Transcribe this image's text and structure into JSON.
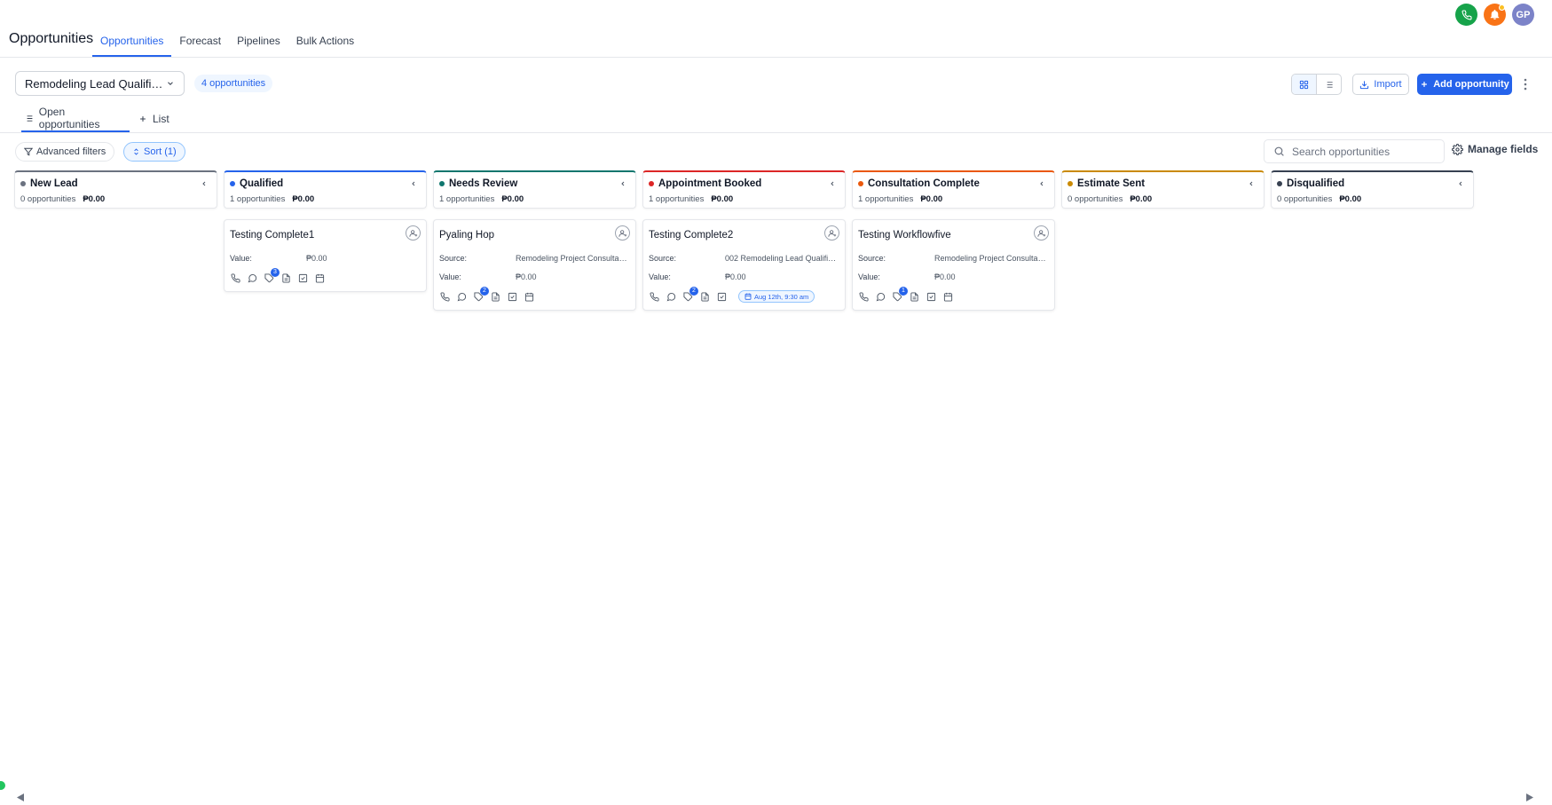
{
  "app": {
    "title": "Opportunities",
    "nav_tabs": [
      "Opportunities",
      "Forecast",
      "Pipelines",
      "Bulk Actions"
    ],
    "user_initials": "GP"
  },
  "toolbar": {
    "pipeline": "Remodeling Lead Qualificati...",
    "count_badge": "4 opportunities",
    "import_label": "Import",
    "add_label": "Add opportunity"
  },
  "subtabs": {
    "open": "Open opportunities",
    "list": "List"
  },
  "filters": {
    "advanced": "Advanced filters",
    "sort": "Sort (1)",
    "search_placeholder": "Search opportunities",
    "manage_fields": "Manage fields"
  },
  "labels": {
    "value": "Value:",
    "source": "Source:"
  },
  "columns": [
    {
      "name": "New Lead",
      "count": "0 opportunities",
      "amount": "₱0.00",
      "color": "#6b7280"
    },
    {
      "name": "Qualified",
      "count": "1 opportunities",
      "amount": "₱0.00",
      "color": "#2563eb"
    },
    {
      "name": "Needs Review",
      "count": "1 opportunities",
      "amount": "₱0.00",
      "color": "#0f766e"
    },
    {
      "name": "Appointment Booked",
      "count": "1 opportunities",
      "amount": "₱0.00",
      "color": "#dc2626"
    },
    {
      "name": "Consultation Complete",
      "count": "1 opportunities",
      "amount": "₱0.00",
      "color": "#ea580c"
    },
    {
      "name": "Estimate Sent",
      "count": "0 opportunities",
      "amount": "₱0.00",
      "color": "#ca8a04"
    },
    {
      "name": "Disqualified",
      "count": "0 opportunities",
      "amount": "₱0.00",
      "color": "#374151"
    }
  ],
  "cards": [
    {
      "title": "Testing Complete1",
      "value": "₱0.00",
      "badge": "3"
    },
    {
      "title": "Pyaling Hop",
      "source": "Remodeling Project Consultati...",
      "value": "₱0.00",
      "badge": "2"
    },
    {
      "title": "Testing Complete2",
      "source": "002 Remodeling Lead Qualific...",
      "value": "₱0.00",
      "badge": "2",
      "appointment": "Aug 12th, 9:30 am"
    },
    {
      "title": "Testing Workflowfive",
      "source": "Remodeling Project Consultati...",
      "value": "₱0.00",
      "badge": "1"
    }
  ]
}
